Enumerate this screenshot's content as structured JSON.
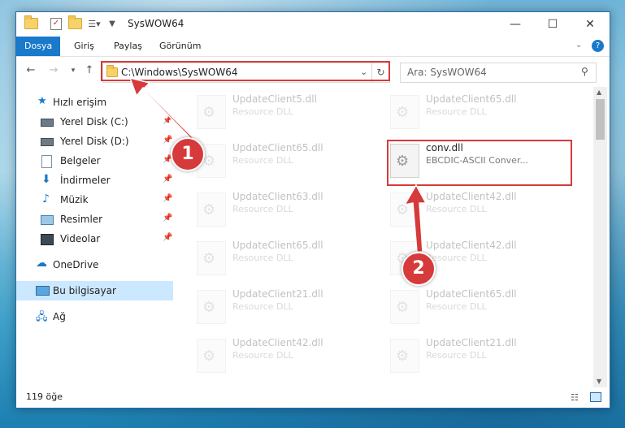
{
  "window": {
    "title": "SysWOW64",
    "controls": {
      "minimize": "—",
      "maximize": "☐",
      "close": "✕"
    }
  },
  "ribbon": {
    "tabs": [
      "Dosya",
      "Giriş",
      "Paylaş",
      "Görünüm"
    ],
    "help": "?"
  },
  "address": {
    "path": "C:\\Windows\\SysWOW64",
    "search_placeholder": "Ara: SysWOW64"
  },
  "sidebar": {
    "items": [
      {
        "label": "Hızlı erişim",
        "icon": "star-icon"
      },
      {
        "label": "Yerel Disk (C:)",
        "icon": "drive-icon"
      },
      {
        "label": "Yerel Disk (D:)",
        "icon": "drive-icon"
      },
      {
        "label": "Belgeler",
        "icon": "documents-icon"
      },
      {
        "label": "İndirmeler",
        "icon": "download-icon"
      },
      {
        "label": "Müzik",
        "icon": "music-icon"
      },
      {
        "label": "Resimler",
        "icon": "pictures-icon"
      },
      {
        "label": "Videolar",
        "icon": "video-icon"
      },
      {
        "label": "OneDrive",
        "icon": "cloud-icon"
      },
      {
        "label": "Bu bilgisayar",
        "icon": "computer-icon"
      },
      {
        "label": "Ağ",
        "icon": "network-icon"
      }
    ]
  },
  "files": [
    {
      "name": "UpdateClient5.dll",
      "desc": "Resource DLL"
    },
    {
      "name": "UpdateClient65.dll",
      "desc": "Resource DLL"
    },
    {
      "name": "UpdateClient65.dll",
      "desc": "Resource DLL"
    },
    {
      "name": "conv.dll",
      "desc": "EBCDIC-ASCII Conver..."
    },
    {
      "name": "UpdateClient63.dll",
      "desc": "Resource DLL"
    },
    {
      "name": "UpdateClient42.dll",
      "desc": "Resource DLL"
    },
    {
      "name": "UpdateClient65.dll",
      "desc": "Resource DLL"
    },
    {
      "name": "UpdateClient42.dll",
      "desc": "Resource DLL"
    },
    {
      "name": "UpdateClient21.dll",
      "desc": "Resource DLL"
    },
    {
      "name": "UpdateClient65.dll",
      "desc": "Resource DLL"
    },
    {
      "name": "UpdateClient42.dll",
      "desc": "Resource DLL"
    },
    {
      "name": "UpdateClient21.dll",
      "desc": "Resource DLL"
    }
  ],
  "status": {
    "count": "119 öğe"
  },
  "annotations": {
    "step1": "1",
    "step2": "2",
    "color": "#d63a3a"
  }
}
